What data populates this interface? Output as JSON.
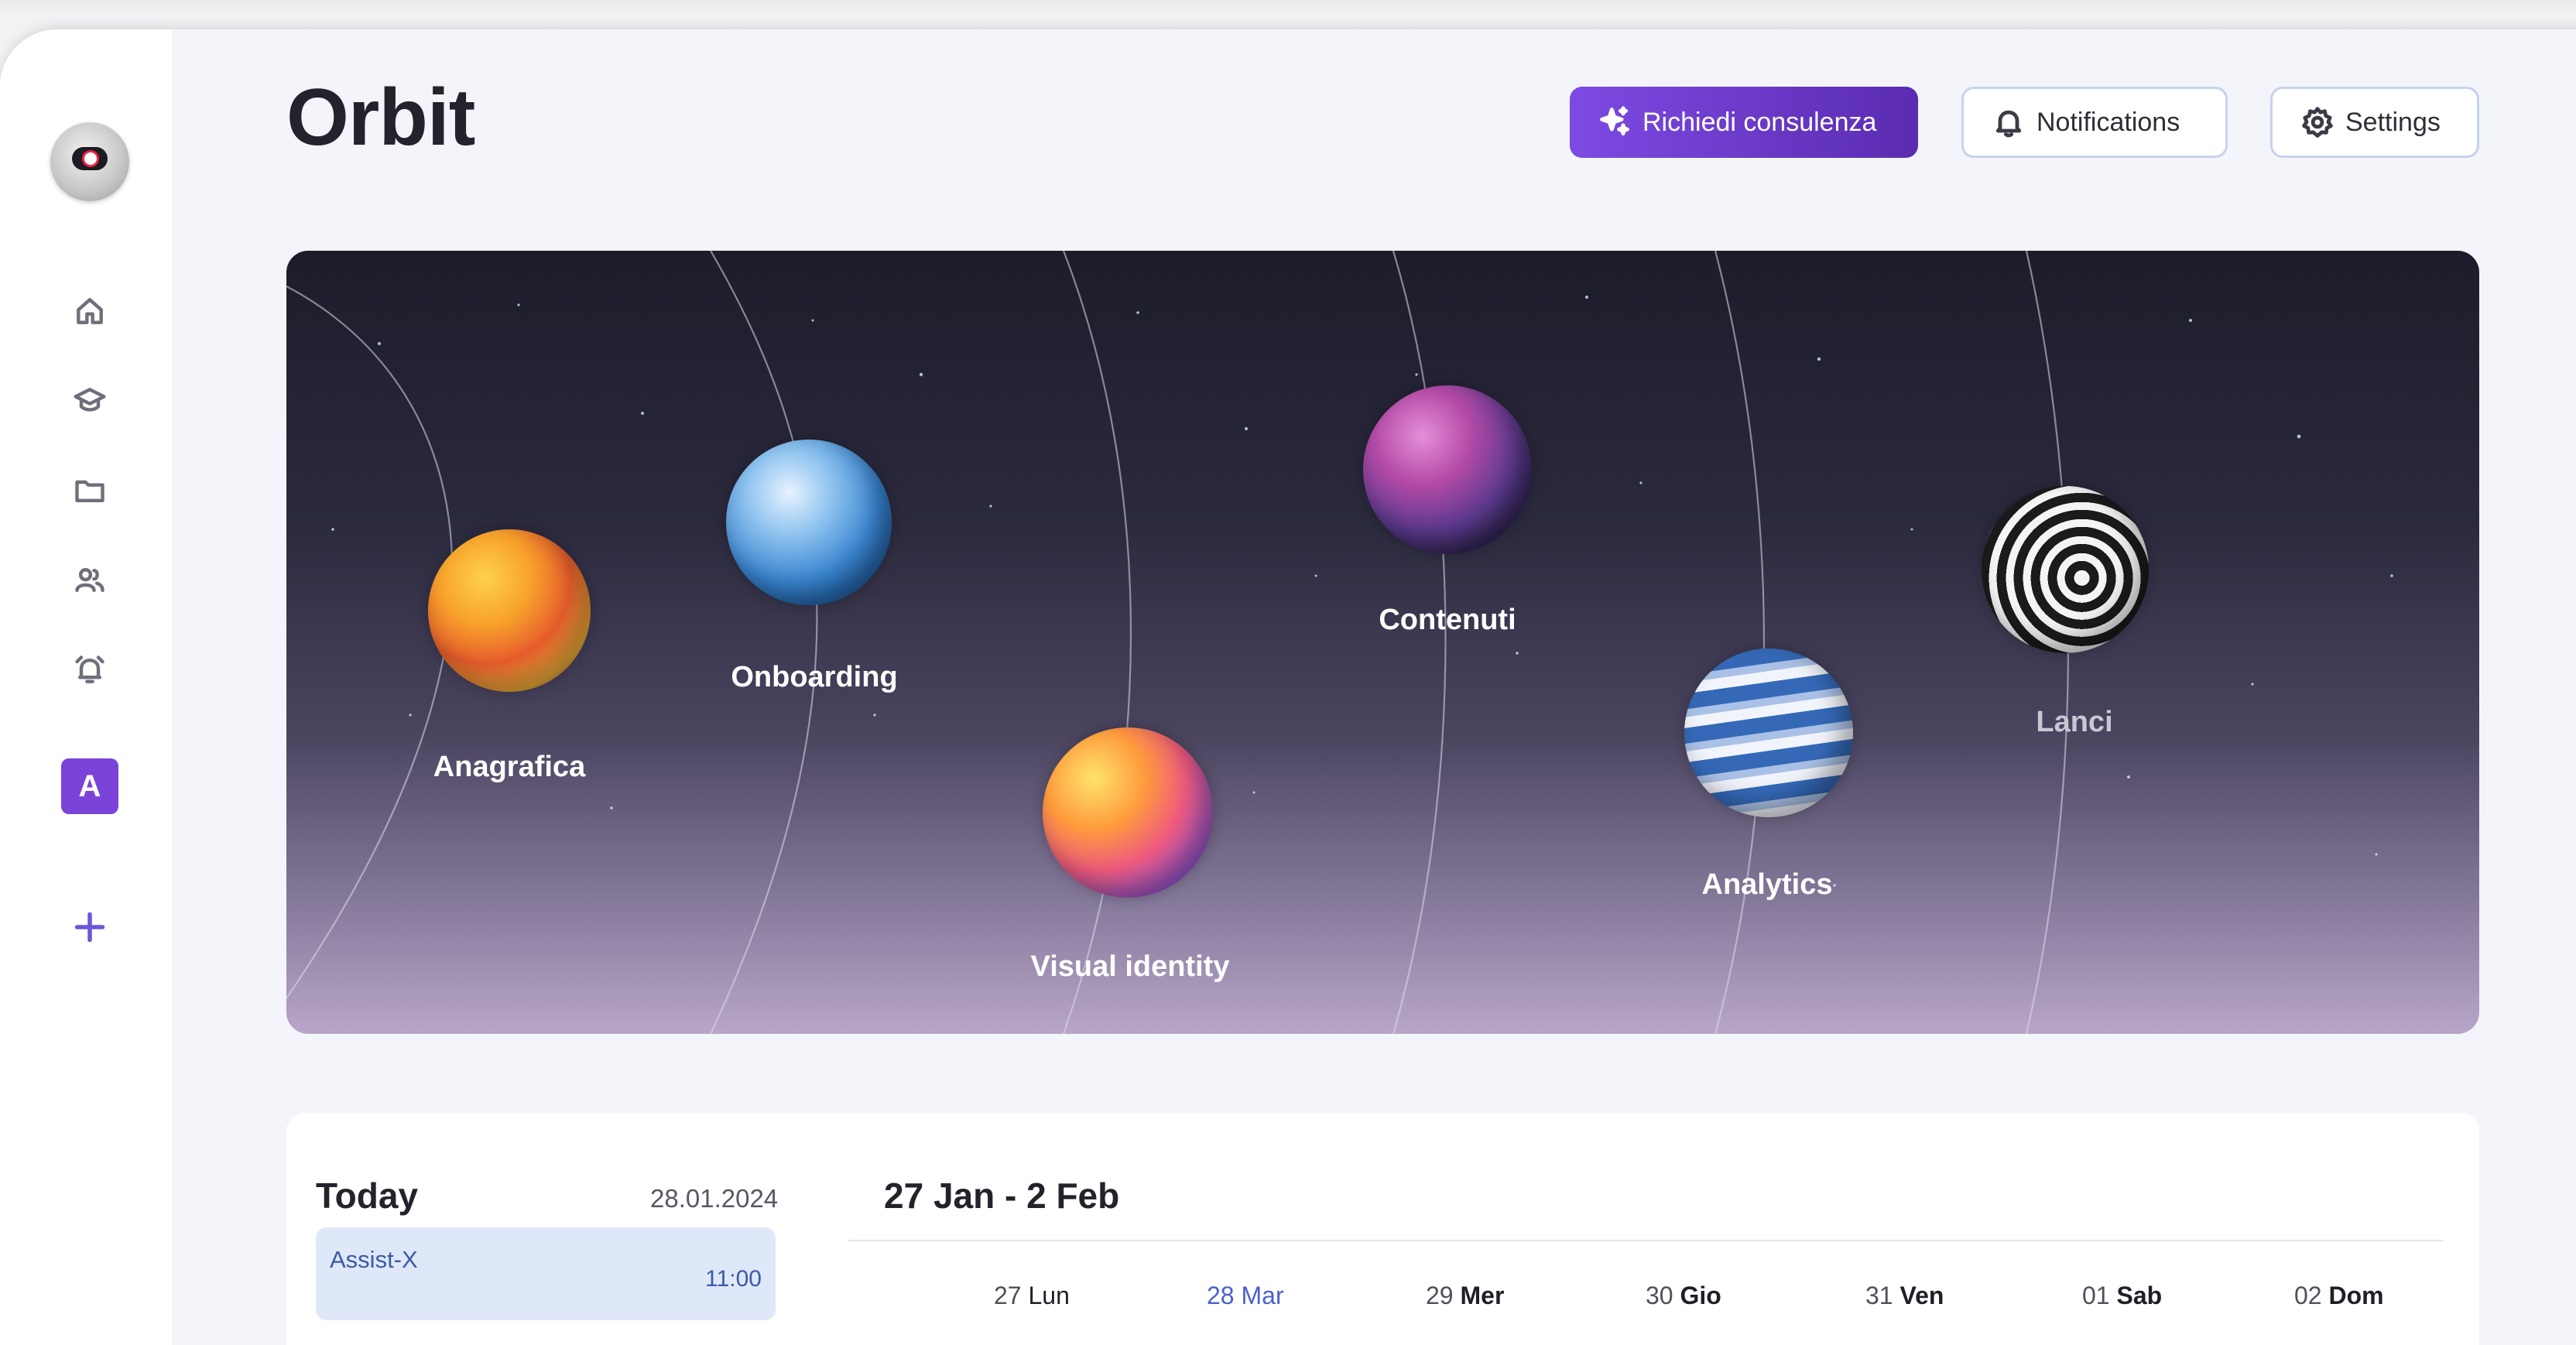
{
  "app": {
    "title": "Orbit"
  },
  "header": {
    "consult_label": "Richiedi consulenza",
    "notifications_label": "Notifications",
    "settings_label": "Settings"
  },
  "sidebar": {
    "items": [
      {
        "icon": "home-icon"
      },
      {
        "icon": "graduation-cap-icon"
      },
      {
        "icon": "folder-icon"
      },
      {
        "icon": "users-icon"
      },
      {
        "icon": "alarm-icon"
      }
    ],
    "workspace_initial": "A",
    "add_icon": "plus-icon"
  },
  "hero": {
    "planets": [
      {
        "label": "Anagrafica"
      },
      {
        "label": "Onboarding"
      },
      {
        "label": "Visual identity"
      },
      {
        "label": "Contenuti"
      },
      {
        "label": "Analytics"
      },
      {
        "label": "Lanci"
      }
    ]
  },
  "today": {
    "title": "Today",
    "date": "28.01.2024",
    "tasks": [
      {
        "name": "Assist-X",
        "time": "11:00"
      }
    ]
  },
  "week": {
    "range": "27 Jan - 2 Feb",
    "days": [
      {
        "num": "27",
        "dow": "Lun"
      },
      {
        "num": "28",
        "dow": "Mar",
        "active": true
      },
      {
        "num": "29",
        "dow": "Mer"
      },
      {
        "num": "30",
        "dow": "Gio"
      },
      {
        "num": "31",
        "dow": "Ven"
      },
      {
        "num": "01",
        "dow": "Sab"
      },
      {
        "num": "02",
        "dow": "Dom"
      }
    ]
  },
  "colors": {
    "accent": "#7b44d9",
    "primary_button": "#6a38c9",
    "active_day": "#4b5fcf"
  }
}
